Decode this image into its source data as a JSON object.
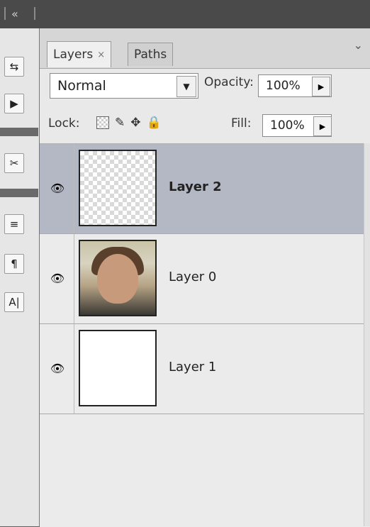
{
  "panel": {
    "tabs": [
      {
        "label": "Layers",
        "close": "×",
        "active": true
      },
      {
        "label": "Paths",
        "active": false
      }
    ],
    "blend_mode": "Normal",
    "opacity_label": "Opacity:",
    "opacity_value": "100%",
    "lock_label": "Lock:",
    "fill_label": "Fill:",
    "fill_value": "100%"
  },
  "layers": [
    {
      "name": "Layer 2",
      "selected": true,
      "thumb": "transparent"
    },
    {
      "name": "Layer 0",
      "selected": false,
      "thumb": "photo"
    },
    {
      "name": "Layer 1",
      "selected": false,
      "thumb": "white"
    }
  ],
  "icons": {
    "collapse": "«",
    "eye": "👁",
    "dropdown": "▼",
    "arrow": "▶"
  }
}
